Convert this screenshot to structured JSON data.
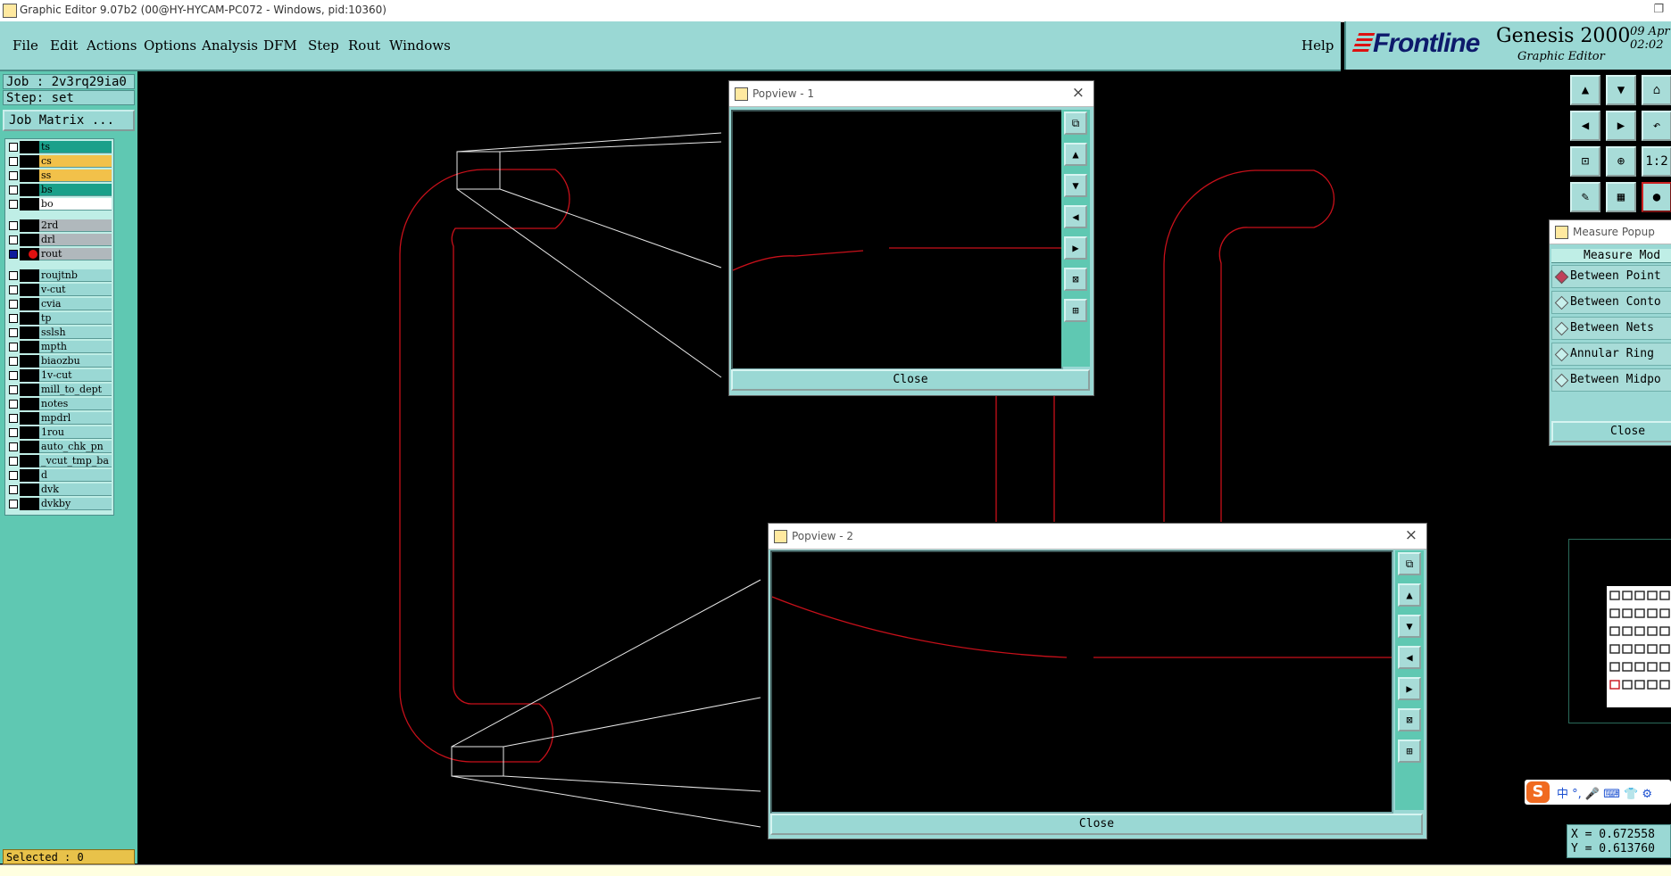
{
  "window": {
    "title": "Graphic Editor 9.07b2 (00@HY-HYCAM-PC072 - Windows, pid:10360)",
    "maximize_glyph": "❐"
  },
  "menu": {
    "items": [
      "File",
      "Edit",
      "Actions",
      "Options",
      "Analysis",
      "DFM",
      "Step",
      "Rout",
      "Windows"
    ],
    "help": "Help"
  },
  "brand": {
    "logo": "Frontline",
    "product": "Genesis 2000",
    "subtitle": "Graphic Editor",
    "date": "09 Apr\n02:02"
  },
  "job_info": {
    "job": "Job : 2v3rq29ia0",
    "step": "Step: set",
    "job_matrix": "Job Matrix ..."
  },
  "layers": [
    {
      "name": "ts",
      "color": "#1aa08a",
      "checked": false
    },
    {
      "name": "cs",
      "color": "#f2c14a",
      "checked": false
    },
    {
      "name": "ss",
      "color": "#f2c14a",
      "checked": false
    },
    {
      "name": "bs",
      "color": "#1aa08a",
      "checked": false
    },
    {
      "name": "bo",
      "color": "#ffffff",
      "checked": false
    },
    {
      "name": "2rd",
      "color": "#b0b8bc",
      "checked": false
    },
    {
      "name": "drl",
      "color": "#b0b8bc",
      "checked": false
    },
    {
      "name": "rout",
      "color": "#b0b8bc",
      "checked": true,
      "marker": "red-dot"
    },
    {
      "name": "roujtnb",
      "color": "#9ad8d4",
      "checked": false
    },
    {
      "name": "v-cut",
      "color": "#9ad8d4",
      "checked": false
    },
    {
      "name": "cvia",
      "color": "#9ad8d4",
      "checked": false
    },
    {
      "name": "tp",
      "color": "#9ad8d4",
      "checked": false
    },
    {
      "name": "sslsh",
      "color": "#9ad8d4",
      "checked": false
    },
    {
      "name": "mpth",
      "color": "#9ad8d4",
      "checked": false
    },
    {
      "name": "biaozbu",
      "color": "#9ad8d4",
      "checked": false
    },
    {
      "name": "1v-cut",
      "color": "#9ad8d4",
      "checked": false
    },
    {
      "name": "mill_to_dept",
      "color": "#9ad8d4",
      "checked": false
    },
    {
      "name": "notes",
      "color": "#9ad8d4",
      "checked": false
    },
    {
      "name": "mpdrl",
      "color": "#9ad8d4",
      "checked": false
    },
    {
      "name": "1rou",
      "color": "#9ad8d4",
      "checked": false
    },
    {
      "name": "auto_chk_pn",
      "color": "#9ad8d4",
      "checked": false
    },
    {
      "name": "_vcut_tmp_ba",
      "color": "#9ad8d4",
      "checked": false
    },
    {
      "name": "d",
      "color": "#9ad8d4",
      "checked": false
    },
    {
      "name": "dvk",
      "color": "#9ad8d4",
      "checked": false
    },
    {
      "name": "dvkby",
      "color": "#9ad8d4",
      "checked": false
    }
  ],
  "selected": "Selected : 0",
  "popview1": {
    "title": "Popview - 1",
    "close_label": "Close",
    "close_glyph": "×"
  },
  "popview2": {
    "title": "Popview - 2",
    "close_label": "Close",
    "close_glyph": "×"
  },
  "pop_tools": [
    "zoom-home-icon",
    "pan-up-icon",
    "pan-down-icon",
    "pan-left-icon",
    "pan-right-icon",
    "zoom-in-icon",
    "zoom-out-icon"
  ],
  "right_tools": [
    "pan-up-icon",
    "pan-down-icon",
    "home-icon",
    "pan-left-icon",
    "pan-right-icon",
    "undo-view-icon",
    "zoom-fit-icon",
    "zoom-in-icon",
    "ratio-1-2-icon",
    "cursor-icon",
    "grid-icon",
    "snap-icon"
  ],
  "ratio_label": "1:2",
  "measure": {
    "title": "Measure Popup",
    "mode_label": "Measure Mod",
    "options": [
      "Between Point",
      "Between Conto",
      "Between Nets",
      "Annular Ring",
      "Between Midpo"
    ],
    "selected_option": 0,
    "close_label": "Close"
  },
  "coords": {
    "x": "X = 0.672558",
    "y": "Y = 0.613760"
  },
  "ime": {
    "logo": "S",
    "text": "中 °, 🎤 ⌨ 👕 ⚙"
  },
  "colors": {
    "rout": "#c8101a",
    "panel": "#9ad8d4",
    "panel_dark": "#5fc8b2",
    "background": "#000000"
  }
}
